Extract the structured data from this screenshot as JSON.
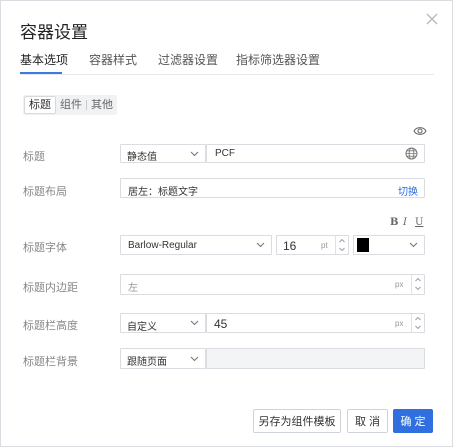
{
  "dialog": {
    "title": "容器设置",
    "tabs": [
      {
        "label": "基本选项"
      },
      {
        "label": "容器样式"
      },
      {
        "label": "过滤器设置"
      },
      {
        "label": "指标筛选器设置"
      }
    ],
    "active_tab": "基本选项",
    "subtabs": [
      {
        "label": "标题"
      },
      {
        "label": "组件"
      },
      {
        "label": "其他"
      }
    ],
    "active_subtab": "标题"
  },
  "form": {
    "title_row": {
      "label": "标题",
      "mode": "静态值",
      "value": "PCF"
    },
    "layout_row": {
      "label": "标题布局",
      "value": "居左：标题文字",
      "switch_label": "切换"
    },
    "font_row": {
      "label": "标题字体",
      "family": "Barlow-Regular",
      "size": "16",
      "unit": "pt",
      "color": "#000000",
      "bold_label": "B",
      "italic_label": "I",
      "underline_label": "U"
    },
    "padding_row": {
      "label": "标题内边距",
      "placeholder": "左",
      "unit": "px"
    },
    "height_row": {
      "label": "标题栏高度",
      "mode": "自定义",
      "value": "45",
      "unit": "px"
    },
    "background_row": {
      "label": "标题栏背景",
      "mode": "跟随页面"
    }
  },
  "footer": {
    "save_template_label": "另存为组件模板",
    "cancel_label": "取 消",
    "confirm_label": "确 定"
  },
  "colors": {
    "accent": "#2f6fe0",
    "border": "#d9dce1",
    "label": "#888888"
  }
}
